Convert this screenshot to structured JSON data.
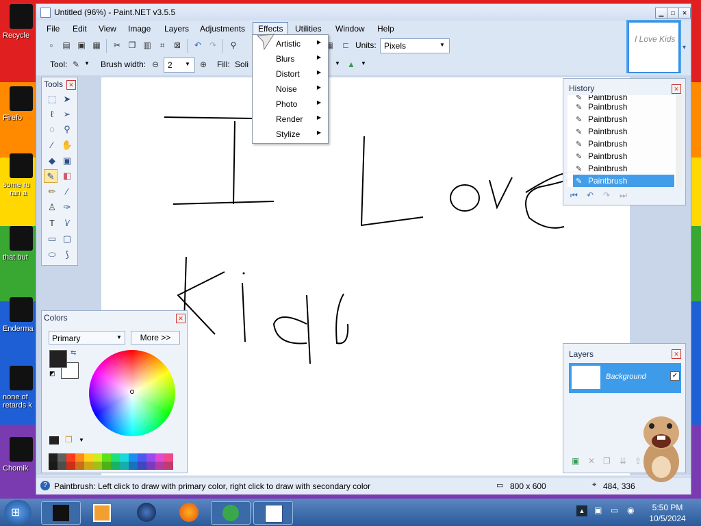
{
  "desktop": {
    "stripes": [
      "#e02020",
      "#ff8a00",
      "#ffd800",
      "#39a832",
      "#1f5fd6",
      "#7a3ab0"
    ],
    "icons": [
      {
        "label": "Recycle"
      },
      {
        "label": "Firefo"
      },
      {
        "label": "some ru"
      },
      {
        "label": "ran a"
      },
      {
        "label": "that but"
      },
      {
        "label": "Enderma"
      },
      {
        "label": "none of"
      },
      {
        "label": "retards k"
      },
      {
        "label": "Chomik"
      }
    ]
  },
  "window": {
    "title": "Untitled (96%) - Paint.NET v3.5.5",
    "menus": [
      "File",
      "Edit",
      "View",
      "Image",
      "Layers",
      "Adjustments",
      "Effects",
      "Utilities",
      "Window",
      "Help"
    ],
    "active_menu": "Effects",
    "units_label": "Units:",
    "units_value": "Pixels",
    "tool_label": "Tool:",
    "brush_width_label": "Brush width:",
    "brush_width_value": "2",
    "fill_label": "Fill:",
    "fill_value": "Soli"
  },
  "effects_menu": {
    "items": [
      "Artistic",
      "Blurs",
      "Distort",
      "Noise",
      "Photo",
      "Render",
      "Stylize"
    ]
  },
  "tools_panel": {
    "title": "Tools"
  },
  "history_panel": {
    "title": "History",
    "items": [
      "Paintbrush",
      "Paintbrush",
      "Paintbrush",
      "Paintbrush",
      "Paintbrush",
      "Paintbrush",
      "Paintbrush",
      "Paintbrush"
    ],
    "selected_index": 7
  },
  "colors_panel": {
    "title": "Colors",
    "dropdown": "Primary",
    "more_button": "More >>",
    "palette": [
      "#202020",
      "#606060",
      "#ff3b1d",
      "#ff8a1d",
      "#ffd21d",
      "#c8f01d",
      "#5fe01d",
      "#1de07a",
      "#1dd8d8",
      "#1d8ef0",
      "#4a5af0",
      "#9a4af0",
      "#e04ad0",
      "#f04a8a"
    ]
  },
  "layers_panel": {
    "title": "Layers",
    "layer_name": "Background"
  },
  "canvas_text": {
    "line1": "I Love",
    "line2": "Kids"
  },
  "thumbnail_text": "I Love Kids",
  "status": {
    "hint": "Paintbrush: Left click to draw with primary color, right click to draw with secondary color",
    "size": "800 x 600",
    "pos": "484, 336"
  },
  "taskbar": {
    "time": "5:50 PM",
    "date": "10/5/2024"
  }
}
